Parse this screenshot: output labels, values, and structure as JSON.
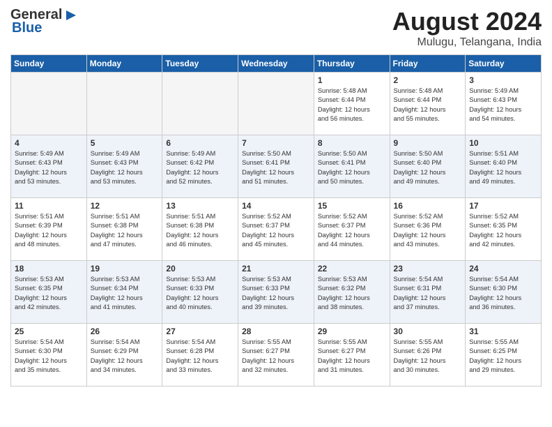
{
  "logo": {
    "line1": "General",
    "line2": "Blue"
  },
  "title": "August 2024",
  "subtitle": "Mulugu, Telangana, India",
  "weekdays": [
    "Sunday",
    "Monday",
    "Tuesday",
    "Wednesday",
    "Thursday",
    "Friday",
    "Saturday"
  ],
  "weeks": [
    [
      {
        "day": "",
        "info": ""
      },
      {
        "day": "",
        "info": ""
      },
      {
        "day": "",
        "info": ""
      },
      {
        "day": "",
        "info": ""
      },
      {
        "day": "1",
        "info": "Sunrise: 5:48 AM\nSunset: 6:44 PM\nDaylight: 12 hours\nand 56 minutes."
      },
      {
        "day": "2",
        "info": "Sunrise: 5:48 AM\nSunset: 6:44 PM\nDaylight: 12 hours\nand 55 minutes."
      },
      {
        "day": "3",
        "info": "Sunrise: 5:49 AM\nSunset: 6:43 PM\nDaylight: 12 hours\nand 54 minutes."
      }
    ],
    [
      {
        "day": "4",
        "info": "Sunrise: 5:49 AM\nSunset: 6:43 PM\nDaylight: 12 hours\nand 53 minutes."
      },
      {
        "day": "5",
        "info": "Sunrise: 5:49 AM\nSunset: 6:43 PM\nDaylight: 12 hours\nand 53 minutes."
      },
      {
        "day": "6",
        "info": "Sunrise: 5:49 AM\nSunset: 6:42 PM\nDaylight: 12 hours\nand 52 minutes."
      },
      {
        "day": "7",
        "info": "Sunrise: 5:50 AM\nSunset: 6:41 PM\nDaylight: 12 hours\nand 51 minutes."
      },
      {
        "day": "8",
        "info": "Sunrise: 5:50 AM\nSunset: 6:41 PM\nDaylight: 12 hours\nand 50 minutes."
      },
      {
        "day": "9",
        "info": "Sunrise: 5:50 AM\nSunset: 6:40 PM\nDaylight: 12 hours\nand 49 minutes."
      },
      {
        "day": "10",
        "info": "Sunrise: 5:51 AM\nSunset: 6:40 PM\nDaylight: 12 hours\nand 49 minutes."
      }
    ],
    [
      {
        "day": "11",
        "info": "Sunrise: 5:51 AM\nSunset: 6:39 PM\nDaylight: 12 hours\nand 48 minutes."
      },
      {
        "day": "12",
        "info": "Sunrise: 5:51 AM\nSunset: 6:38 PM\nDaylight: 12 hours\nand 47 minutes."
      },
      {
        "day": "13",
        "info": "Sunrise: 5:51 AM\nSunset: 6:38 PM\nDaylight: 12 hours\nand 46 minutes."
      },
      {
        "day": "14",
        "info": "Sunrise: 5:52 AM\nSunset: 6:37 PM\nDaylight: 12 hours\nand 45 minutes."
      },
      {
        "day": "15",
        "info": "Sunrise: 5:52 AM\nSunset: 6:37 PM\nDaylight: 12 hours\nand 44 minutes."
      },
      {
        "day": "16",
        "info": "Sunrise: 5:52 AM\nSunset: 6:36 PM\nDaylight: 12 hours\nand 43 minutes."
      },
      {
        "day": "17",
        "info": "Sunrise: 5:52 AM\nSunset: 6:35 PM\nDaylight: 12 hours\nand 42 minutes."
      }
    ],
    [
      {
        "day": "18",
        "info": "Sunrise: 5:53 AM\nSunset: 6:35 PM\nDaylight: 12 hours\nand 42 minutes."
      },
      {
        "day": "19",
        "info": "Sunrise: 5:53 AM\nSunset: 6:34 PM\nDaylight: 12 hours\nand 41 minutes."
      },
      {
        "day": "20",
        "info": "Sunrise: 5:53 AM\nSunset: 6:33 PM\nDaylight: 12 hours\nand 40 minutes."
      },
      {
        "day": "21",
        "info": "Sunrise: 5:53 AM\nSunset: 6:33 PM\nDaylight: 12 hours\nand 39 minutes."
      },
      {
        "day": "22",
        "info": "Sunrise: 5:53 AM\nSunset: 6:32 PM\nDaylight: 12 hours\nand 38 minutes."
      },
      {
        "day": "23",
        "info": "Sunrise: 5:54 AM\nSunset: 6:31 PM\nDaylight: 12 hours\nand 37 minutes."
      },
      {
        "day": "24",
        "info": "Sunrise: 5:54 AM\nSunset: 6:30 PM\nDaylight: 12 hours\nand 36 minutes."
      }
    ],
    [
      {
        "day": "25",
        "info": "Sunrise: 5:54 AM\nSunset: 6:30 PM\nDaylight: 12 hours\nand 35 minutes."
      },
      {
        "day": "26",
        "info": "Sunrise: 5:54 AM\nSunset: 6:29 PM\nDaylight: 12 hours\nand 34 minutes."
      },
      {
        "day": "27",
        "info": "Sunrise: 5:54 AM\nSunset: 6:28 PM\nDaylight: 12 hours\nand 33 minutes."
      },
      {
        "day": "28",
        "info": "Sunrise: 5:55 AM\nSunset: 6:27 PM\nDaylight: 12 hours\nand 32 minutes."
      },
      {
        "day": "29",
        "info": "Sunrise: 5:55 AM\nSunset: 6:27 PM\nDaylight: 12 hours\nand 31 minutes."
      },
      {
        "day": "30",
        "info": "Sunrise: 5:55 AM\nSunset: 6:26 PM\nDaylight: 12 hours\nand 30 minutes."
      },
      {
        "day": "31",
        "info": "Sunrise: 5:55 AM\nSunset: 6:25 PM\nDaylight: 12 hours\nand 29 minutes."
      }
    ]
  ]
}
